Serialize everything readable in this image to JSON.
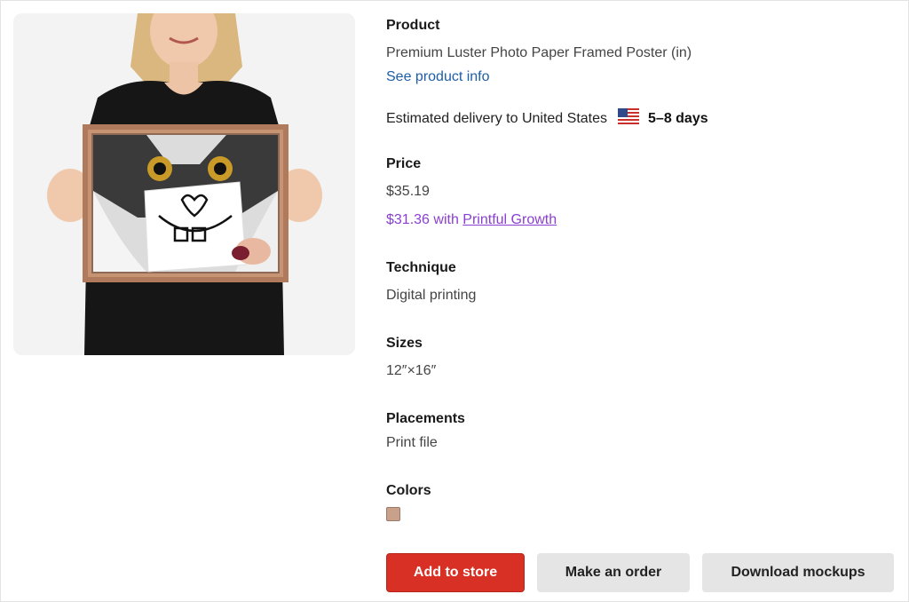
{
  "product": {
    "label": "Product",
    "name": "Premium Luster Photo Paper Framed Poster (in)",
    "info_link": "See product info"
  },
  "delivery": {
    "text": "Estimated delivery to United States",
    "flag_icon": "us-flag-icon",
    "days": "5–8 days"
  },
  "price": {
    "label": "Price",
    "regular": "$35.19",
    "discount_prefix": "$31.36 with",
    "discount_link": "Printful Growth"
  },
  "technique": {
    "label": "Technique",
    "value": "Digital printing"
  },
  "sizes": {
    "label": "Sizes",
    "value": "12″×16″"
  },
  "placements": {
    "label": "Placements",
    "value": "Print file"
  },
  "colors": {
    "label": "Colors",
    "swatch": "#c9a08a"
  },
  "buttons": {
    "add_to_store": "Add to store",
    "make_order": "Make an order",
    "download_mockups": "Download mockups"
  },
  "accent_colors": {
    "primary_button": "#d93025",
    "link": "#1d5ea8",
    "growth": "#8a3fd1"
  }
}
